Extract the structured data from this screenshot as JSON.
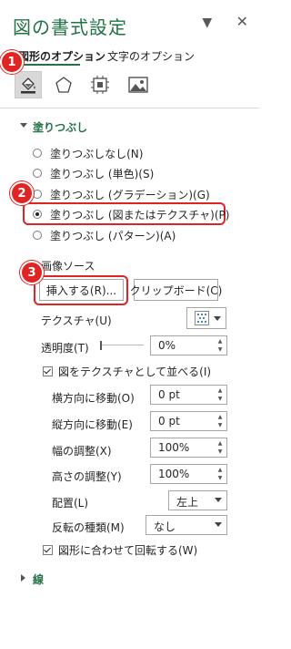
{
  "pane": {
    "title": "図の書式設定",
    "dropdown_glyph": "▼",
    "close_glyph": "✕"
  },
  "tabs": [
    {
      "label": "図形のオプション"
    },
    {
      "label": "文字のオプション"
    }
  ],
  "icons": {
    "fill": "paint-bucket-icon",
    "effects": "pentagon-icon",
    "size": "size-properties-icon",
    "picture": "picture-icon"
  },
  "fill_section": {
    "header": "塗りつぶし",
    "options": [
      {
        "label": "塗りつぶしなし(N)",
        "selected": false
      },
      {
        "label": "塗りつぶし (単色)(S)",
        "selected": false
      },
      {
        "label": "塗りつぶし (グラデーション)(G)",
        "selected": false
      },
      {
        "label": "塗りつぶし (図またはテクスチャ)(P)",
        "selected": true
      },
      {
        "label": "塗りつぶし (パターン)(A)",
        "selected": false
      }
    ],
    "image_source_label": "画像ソース",
    "insert_button": "挿入する(R)...",
    "clipboard_button": "クリップボード(C)",
    "texture_label": "テクスチャ(U)",
    "transparency_label": "透明度(T)",
    "transparency_value": "0%",
    "tile_checkbox": {
      "label": "図をテクスチャとして並べる(I)",
      "checked": true
    },
    "offset_x_label": "横方向に移動(O)",
    "offset_x_value": "0 pt",
    "offset_y_label": "縦方向に移動(E)",
    "offset_y_value": "0 pt",
    "scale_x_label": "幅の調整(X)",
    "scale_x_value": "100%",
    "scale_y_label": "高さの調整(Y)",
    "scale_y_value": "100%",
    "alignment_label": "配置(L)",
    "alignment_value": "左上",
    "mirror_label": "反転の種類(M)",
    "mirror_value": "なし",
    "rotate_checkbox": {
      "label": "図形に合わせて回転する(W)",
      "checked": true
    }
  },
  "line_section": {
    "header": "線"
  },
  "markers": [
    "1",
    "2",
    "3"
  ],
  "colors": {
    "accent": "#217346",
    "marker": "#e02424"
  }
}
